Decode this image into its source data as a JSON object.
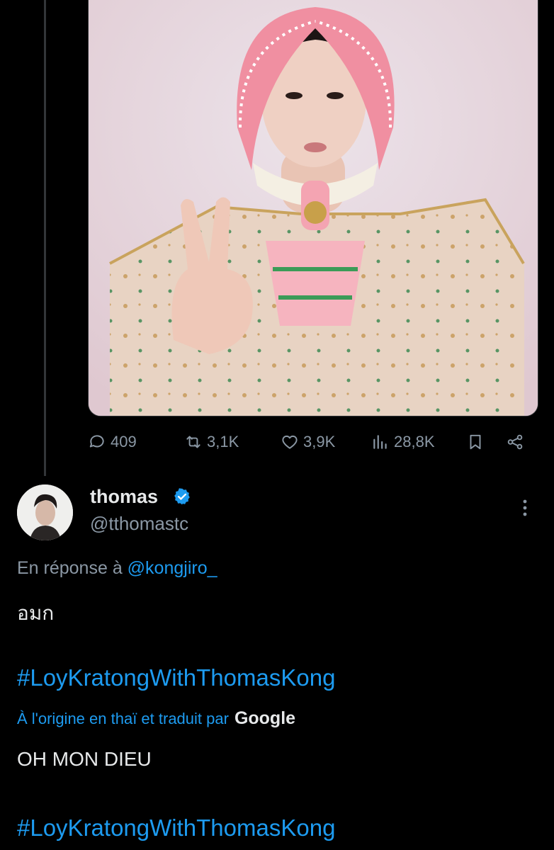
{
  "photo": {
    "alt": ""
  },
  "actions": {
    "replies": "409",
    "reposts": "3,1K",
    "likes": "3,9K",
    "views": "28,8K"
  },
  "reply_tweet": {
    "display_name": "thomas",
    "handle": "@tthomastc",
    "reply_prefix": "En réponse à",
    "reply_mention": "@kongjiro_",
    "original_text": "อมก",
    "hashtag_original": "#LoyKratongWithThomasKong",
    "translated_label": "À l'origine en thaï et traduit par",
    "translator": "Google",
    "translated_text": "OH MON DIEU",
    "hashtag_translated": "#LoyKratongWithThomasKong"
  },
  "colors": {
    "background": "#000000",
    "text_primary": "#e7e9ea",
    "text_secondary": "#8b98a5",
    "accent": "#1d9bf0",
    "divider": "#333639"
  },
  "icons": {
    "reply": "speech-bubble-icon",
    "repost": "repost-arrows-icon",
    "like": "heart-icon",
    "views": "bar-chart-icon",
    "bookmark": "bookmark-icon",
    "share": "share-icon",
    "verified": "verified-badge-icon",
    "more": "vertical-dots-icon"
  }
}
